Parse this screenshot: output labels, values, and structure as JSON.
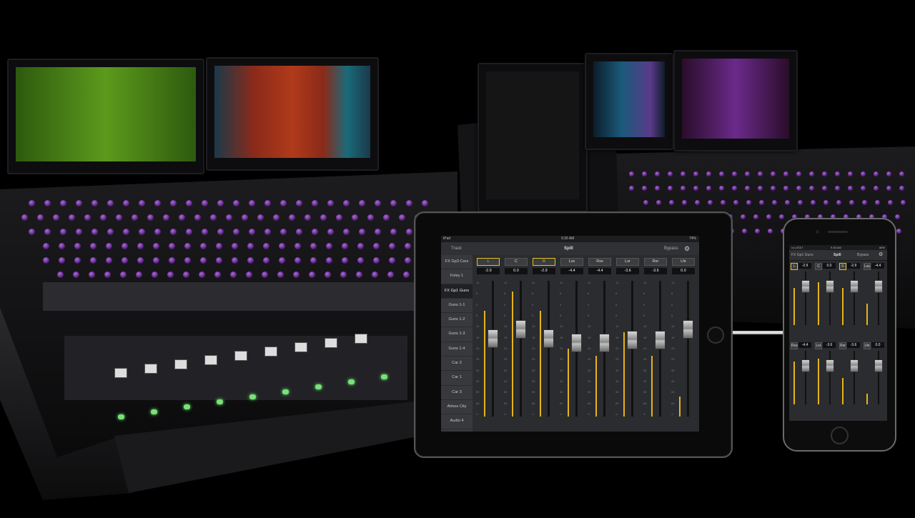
{
  "ipad": {
    "status_left": "iPad",
    "status_time": "9:35 AM",
    "status_right": "74%",
    "nav_left": "Track",
    "title": "Spill",
    "bypass": "Bypass",
    "settings_icon": "gear-icon",
    "sidebar": [
      {
        "label": "FX Gp3 Cars",
        "active": false
      },
      {
        "label": "Foley 1",
        "active": false
      },
      {
        "label": "FX Gp1 Guns",
        "active": true
      },
      {
        "label": "Guns 1-1",
        "active": false
      },
      {
        "label": "Guns 1-2",
        "active": false
      },
      {
        "label": "Guns 1-3",
        "active": false
      },
      {
        "label": "Guns 1-4",
        "active": false
      },
      {
        "label": "Car 2",
        "active": false
      },
      {
        "label": "Car 1",
        "active": false
      },
      {
        "label": "Car 3",
        "active": false
      },
      {
        "label": "Atmos City",
        "active": false
      },
      {
        "label": "Audio 4",
        "active": false
      }
    ],
    "channels": [
      {
        "name": "L",
        "value": "-2.9",
        "selected": true,
        "fader": 0.42,
        "meter": 0.78
      },
      {
        "name": "C",
        "value": "0.0",
        "selected": false,
        "fader": 0.35,
        "meter": 0.92
      },
      {
        "name": "R",
        "value": "-2.9",
        "selected": true,
        "fader": 0.42,
        "meter": 0.78
      },
      {
        "name": "Lss",
        "value": "-4.4",
        "selected": false,
        "fader": 0.45,
        "meter": 0.5
      },
      {
        "name": "Rss",
        "value": "-4.4",
        "selected": false,
        "fader": 0.45,
        "meter": 0.45
      },
      {
        "name": "Lsr",
        "value": "-3.6",
        "selected": false,
        "fader": 0.43,
        "meter": 0.62
      },
      {
        "name": "Rsr",
        "value": "-3.6",
        "selected": false,
        "fader": 0.43,
        "meter": 0.45
      },
      {
        "name": "Lfe",
        "value": "0.0",
        "selected": false,
        "fader": 0.35,
        "meter": 0.15
      }
    ],
    "scale_ticks": [
      "12",
      "6",
      "0",
      "5",
      "10",
      "15",
      "20",
      "25",
      "30",
      "40",
      "50",
      "60",
      "∞"
    ]
  },
  "iphone": {
    "status_left": "•••• AT&T",
    "status_time": "9:35 AM",
    "status_right": "86%",
    "nav_left": "FX Gp1 Guns",
    "title": "Spill",
    "bypass": "Bypass",
    "settings_icon": "gear-icon",
    "row1": [
      {
        "name": "L",
        "value": "-2.9",
        "selected": true,
        "meter": 0.7
      },
      {
        "name": "C",
        "value": "0.0",
        "selected": false,
        "meter": 0.8
      },
      {
        "name": "R",
        "value": "-2.9",
        "selected": true,
        "meter": 0.7
      },
      {
        "name": "Lss",
        "value": "-4.4",
        "selected": false,
        "meter": 0.4
      }
    ],
    "row2": [
      {
        "name": "Rss",
        "value": "-4.4",
        "selected": false,
        "meter": 0.8
      },
      {
        "name": "Lsr",
        "value": "-3.6",
        "selected": false,
        "meter": 0.85
      },
      {
        "name": "Rsr",
        "value": "-3.6",
        "selected": false,
        "meter": 0.5
      },
      {
        "name": "Lfe",
        "value": "0.0",
        "selected": false,
        "meter": 0.2
      }
    ]
  },
  "colors": {
    "accent": "#e6c11a",
    "meter": "#e6b31a",
    "knob": "#8a3cc4",
    "mon_green": "#4a7a18",
    "mon_red": "#8a2a1a",
    "mon_teal": "#1a6a7a"
  }
}
